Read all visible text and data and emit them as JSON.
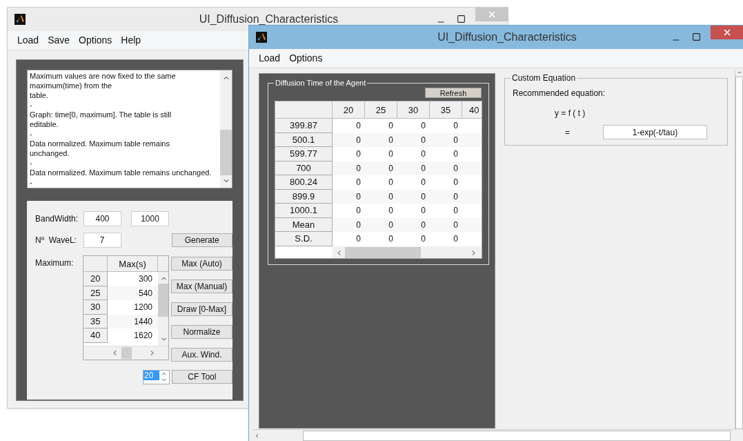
{
  "back_window": {
    "title": "UI_Diffusion_Characteristics",
    "active": false,
    "menu": [
      "Load",
      "Save",
      "Options",
      "Help"
    ],
    "log_lines": [
      "Maximum values are now fixed to the same",
      "maximum(time) from the",
      "table.",
      "-",
      "Graph: time[0, maximum]. The table is still",
      "editable.",
      "-",
      "Data normalized. Maximum table remains",
      "unchanged.",
      "-",
      "Data normalized. Maximum table remains unchanged.",
      "-"
    ],
    "bandwidth": {
      "label": "BandWidth:",
      "from": "400",
      "to": "1000"
    },
    "wavelengths": {
      "label": "Nº  WaveL:",
      "value": "7"
    },
    "maximum": {
      "label": "Maximum:",
      "column": "Max(s)",
      "rows": [
        {
          "label": "20",
          "value": "300"
        },
        {
          "label": "25",
          "value": "540"
        },
        {
          "label": "30",
          "value": "1200"
        },
        {
          "label": "35",
          "value": "1440"
        },
        {
          "label": "40",
          "value": "1620"
        }
      ]
    },
    "list": [
      {
        "label": "20",
        "selected": true
      }
    ],
    "buttons": {
      "generate": "Generate",
      "side": [
        "Max (Auto)",
        "Max (Manual)",
        "Draw [0-Max]",
        "Normalize",
        "Aux. Wind."
      ],
      "cf_tool": "CF Tool"
    }
  },
  "front_window": {
    "title": "UI_Diffusion_Characteristics",
    "active": true,
    "menu": [
      "Load",
      "Options"
    ],
    "diffusion": {
      "title": "Diffusion Time of the Agent",
      "refresh": "Refresh",
      "columns": [
        "20",
        "25",
        "30",
        "35",
        "40"
      ],
      "rows": [
        {
          "label": "399.87",
          "values": [
            "0",
            "0",
            "0",
            "0"
          ]
        },
        {
          "label": "500.1",
          "values": [
            "0",
            "0",
            "0",
            "0"
          ]
        },
        {
          "label": "599.77",
          "values": [
            "0",
            "0",
            "0",
            "0"
          ]
        },
        {
          "label": "700",
          "values": [
            "0",
            "0",
            "0",
            "0"
          ]
        },
        {
          "label": "800.24",
          "values": [
            "0",
            "0",
            "0",
            "0"
          ]
        },
        {
          "label": "899.9",
          "values": [
            "0",
            "0",
            "0",
            "0"
          ]
        },
        {
          "label": "1000.1",
          "values": [
            "0",
            "0",
            "0",
            "0"
          ]
        },
        {
          "label": "Mean",
          "values": [
            "0",
            "0",
            "0",
            "0"
          ]
        },
        {
          "label": "S.D.",
          "values": [
            "0",
            "0",
            "0",
            "0"
          ]
        }
      ]
    },
    "equation": {
      "title": "Custom Equation",
      "caption": "Recommended equation:",
      "function": "y = f ( t )",
      "equals": "=",
      "value": "1-exp(-t/tau)"
    }
  }
}
